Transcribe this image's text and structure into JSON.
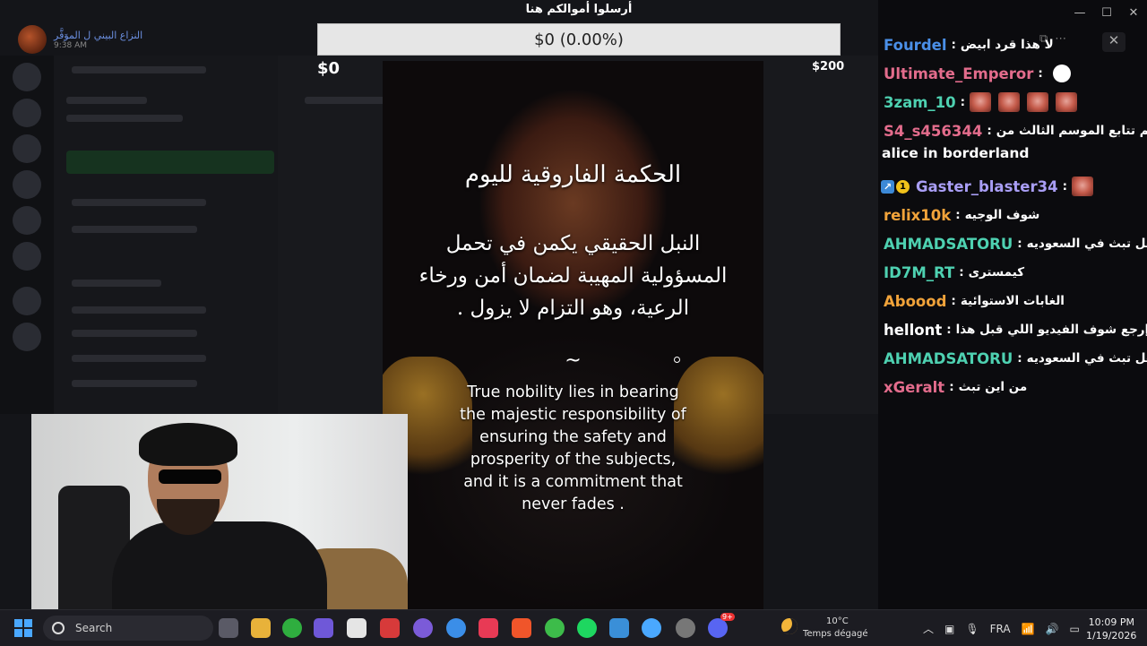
{
  "notification": {
    "name": "النزاع البيني ل الموَفَّر",
    "time": "9:38 AM"
  },
  "donation": {
    "title": "أرسلوا أموالكم هنا",
    "progress_label": "$0 (0.00%)",
    "progress": 0.0,
    "min": "$0",
    "max": "$200"
  },
  "video": {
    "ar_title": "الحكمة الفاروقية لليوم",
    "ar_body": "النبل الحقيقي يكمن في تحمل المسؤولية المهيبة لضمان أمن ورخاء الرعية، وهو التزام لا يزول .",
    "tilde": "~",
    "en_body": "True nobility lies in bearing the majestic responsibility of ensuring the safety and prosperity of the subjects, and it is a commitment that never fades ."
  },
  "chat": {
    "sep": ":",
    "messages": [
      {
        "user": "Fourdel",
        "color": "#4a8fe7",
        "text": "لا هذا قرد ابيض"
      },
      {
        "user": "Ultimate_Emperor",
        "color": "#e36c8c",
        "text": ""
      },
      {
        "user": "3zam_10",
        "color": "#4ed1b1",
        "text": ""
      },
      {
        "user": "S4_s456344",
        "color": "#e36c8c",
        "text": "لماذا لم تتابع الموسم الثالث من"
      },
      {
        "user": "Gaster_blaster34",
        "color": "#a99ef5",
        "text": ""
      },
      {
        "user": "relix10k",
        "color": "#f1a33a",
        "text": "شوف الوجيه"
      },
      {
        "user": "AHMADSATORU",
        "color": "#4ed1b1",
        "text": "هل تبث في السعوديه"
      },
      {
        "user": "ID7M_RT",
        "color": "#4ed1b1",
        "text": "كيمسترى"
      },
      {
        "user": "Aboood",
        "color": "#f1a33a",
        "text": "الغابات الاستوائية"
      },
      {
        "user": "hellont",
        "color": "#ffffff",
        "text": "إرجع شوف الفيديو اللي قبل هذا"
      },
      {
        "user": "AHMADSATORU",
        "color": "#4ed1b1",
        "text": "هل تبث في السعوديه"
      },
      {
        "user": "xGeralt",
        "color": "#e36c8c",
        "text": "من اين تبث"
      }
    ],
    "continuation": "alice in borderland",
    "badge_rank": "1"
  },
  "window": {
    "minimize": "—",
    "maximize": "☐",
    "close": "✕"
  },
  "taskbar": {
    "search_placeholder": "Search",
    "temperature": "10°C",
    "weather_text": "Temps dégagé",
    "language": "FRA",
    "time": "10:09 PM",
    "date": "1/19/2026",
    "discord_badge": "9+"
  }
}
